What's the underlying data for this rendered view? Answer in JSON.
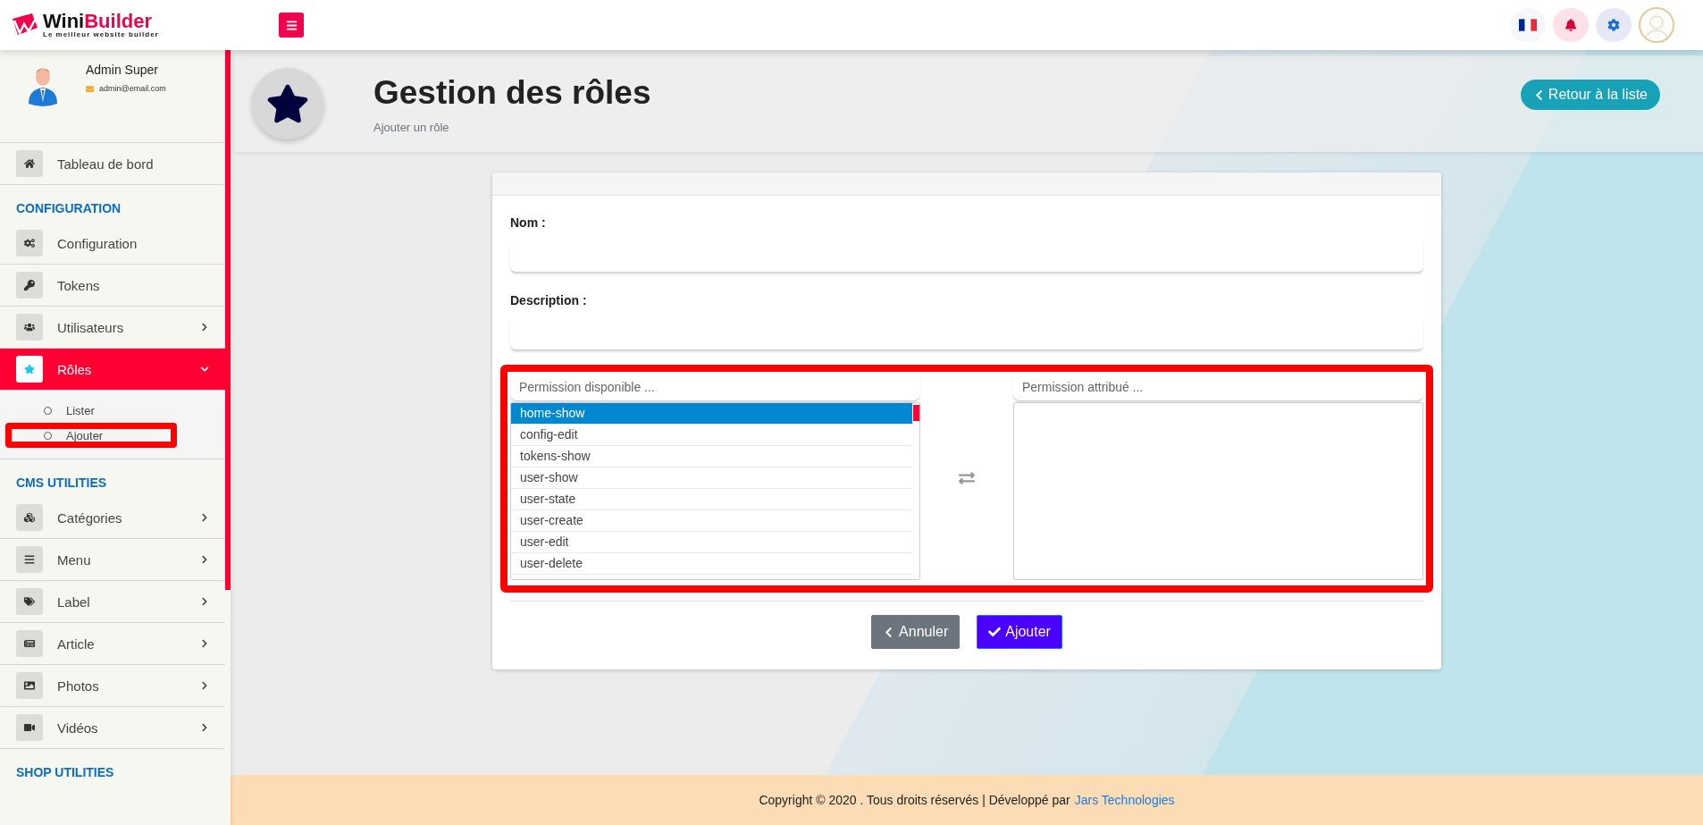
{
  "topbar": {
    "logo": {
      "first": "Wini",
      "second": "Builder",
      "tagline": "Le meilleur website builder"
    }
  },
  "sidebar": {
    "user": {
      "name": "Admin Super",
      "email": "admin@email.com"
    },
    "entries": [
      {
        "kind": "item",
        "label": "Tableau de bord",
        "selected": false
      },
      {
        "kind": "heading",
        "label": "CONFIGURATION"
      },
      {
        "kind": "item",
        "label": "Configuration",
        "selected": false
      },
      {
        "kind": "item",
        "label": "Tokens",
        "selected": false
      },
      {
        "kind": "item",
        "label": "Utilisateurs",
        "selected": false,
        "expanded": false
      },
      {
        "kind": "item",
        "label": "Rôles",
        "selected": true,
        "expanded": true,
        "children": [
          {
            "label": "Lister",
            "highlighted": false
          },
          {
            "label": "Ajouter",
            "highlighted": true
          }
        ]
      },
      {
        "kind": "heading",
        "label": "CMS UTILITIES"
      },
      {
        "kind": "item",
        "label": "Catégories",
        "selected": false,
        "expanded": false
      },
      {
        "kind": "item",
        "label": "Menu",
        "selected": false,
        "expanded": false
      },
      {
        "kind": "item",
        "label": "Label",
        "selected": false,
        "expanded": false
      },
      {
        "kind": "item",
        "label": "Article",
        "selected": false,
        "expanded": false
      },
      {
        "kind": "item",
        "label": "Photos",
        "selected": false,
        "expanded": false
      },
      {
        "kind": "item",
        "label": "Vidéos",
        "selected": false,
        "expanded": false
      },
      {
        "kind": "heading",
        "label": "SHOP UTILITIES"
      }
    ]
  },
  "page_header": {
    "title": "Gestion des rôles",
    "subtitle": "Ajouter un rôle",
    "back_button": "Retour à la liste"
  },
  "form": {
    "fields": [
      {
        "label": "Nom :"
      },
      {
        "label": "Description :"
      }
    ],
    "permissions": {
      "highlighted": true,
      "available_placeholder": "Permission disponible ...",
      "assigned_placeholder": "Permission attribué ...",
      "available": [
        {
          "label": "home-show",
          "selected": true
        },
        {
          "label": "config-edit",
          "selected": false
        },
        {
          "label": "tokens-show",
          "selected": false
        },
        {
          "label": "user-show",
          "selected": false
        },
        {
          "label": "user-state",
          "selected": false
        },
        {
          "label": "user-create",
          "selected": false
        },
        {
          "label": "user-edit",
          "selected": false
        },
        {
          "label": "user-delete",
          "selected": false
        }
      ]
    },
    "actions": [
      {
        "kind": "cancel",
        "label": "Annuler"
      },
      {
        "kind": "submit",
        "label": "Ajouter"
      }
    ]
  },
  "footer": {
    "text": "Copyright © 2020 . Tous droits réservés | Développé par",
    "link": "Jars Technologies"
  }
}
